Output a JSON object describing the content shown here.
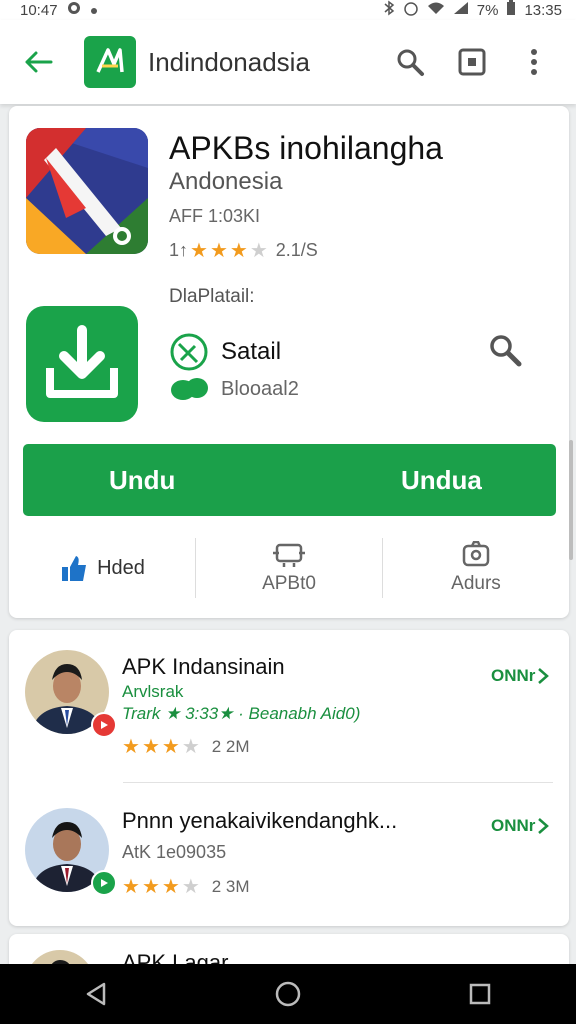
{
  "status_bar": {
    "time": "10:47",
    "battery": "7%",
    "clock_right": "13:35"
  },
  "app_bar": {
    "title": "Indindonadsia"
  },
  "app": {
    "title": "APKBs inohilangha",
    "subtitle": "Andonesia",
    "size": "AFF 1:03KI",
    "rating_prefix": "1↑",
    "rating_stars": 3,
    "rating_count": "2.1/S"
  },
  "detail": {
    "label": "DlaPlatail:",
    "title": "Satail",
    "subtitle": "Blooaal2"
  },
  "unduh_button": {
    "left_label": "Undu",
    "right_label": "Undua"
  },
  "actions": [
    {
      "label": "Hded"
    },
    {
      "label": "APBt0"
    },
    {
      "label": "Adurs"
    }
  ],
  "list": [
    {
      "title": "APK Indansinain",
      "developer": "Arvlsrak",
      "meta": "Trark ★ 3:33★ · Beanabh Aid0)",
      "stars": 3,
      "count": "2 2M",
      "open_label": "ONNr",
      "badge_color": "#e53935"
    },
    {
      "title": "Pnnn yenakaivikendanghk...",
      "subtitle": "AtK 1e09035",
      "stars": 3,
      "count": "2 3M",
      "open_label": "ONNr",
      "badge_color": "#1aa34a"
    },
    {
      "title": "APK Lagar"
    }
  ],
  "colors": {
    "accent": "#1aa34a",
    "star": "#f29b1e"
  }
}
